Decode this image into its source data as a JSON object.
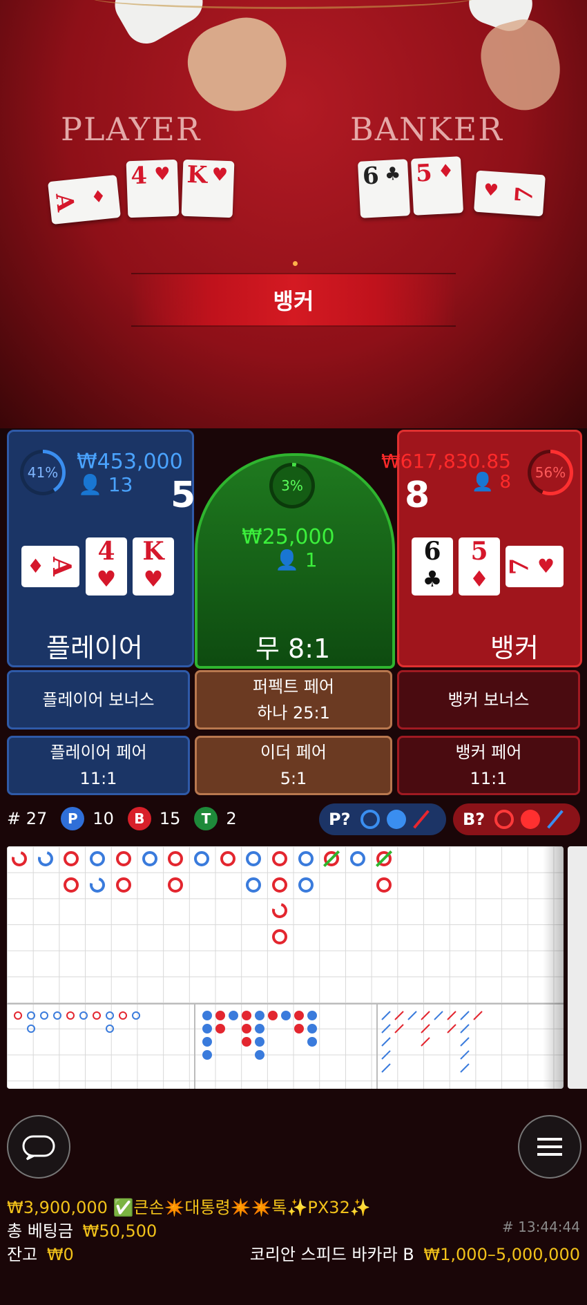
{
  "table": {
    "player_label": "PLAYER",
    "banker_label": "BANKER",
    "result_banner": "뱅커",
    "player_cards": [
      {
        "rank": "A",
        "suit": "♦",
        "color": "red"
      },
      {
        "rank": "4",
        "suit": "♥",
        "color": "red"
      },
      {
        "rank": "K",
        "suit": "♥",
        "color": "red"
      }
    ],
    "banker_cards": [
      {
        "rank": "6",
        "suit": "♣",
        "color": "black"
      },
      {
        "rank": "5",
        "suit": "♦",
        "color": "red"
      },
      {
        "rank": "7",
        "suit": "♥",
        "color": "red"
      }
    ]
  },
  "player": {
    "percent": "41%",
    "percent_value": 41,
    "amount": "₩453,000",
    "bettors": "13",
    "score": "5",
    "label": "플레이어",
    "cards": [
      {
        "rank": "A",
        "suit": "♦"
      },
      {
        "rank": "4",
        "suit": "♥"
      },
      {
        "rank": "K",
        "suit": "♥"
      }
    ]
  },
  "tie": {
    "percent": "3%",
    "percent_value": 3,
    "amount": "₩25,000",
    "bettors": "1",
    "label": "무 8:1"
  },
  "banker": {
    "percent": "56%",
    "percent_value": 56,
    "amount": "₩617,830.85",
    "bettors": "8",
    "score": "8",
    "label": "뱅커",
    "cards": [
      {
        "rank": "6",
        "suit": "♣"
      },
      {
        "rank": "5",
        "suit": "♦"
      },
      {
        "rank": "7",
        "suit": "♥"
      }
    ]
  },
  "side_bets": {
    "player_bonus": "플레이어 보너스",
    "perfect_pair_line1": "퍼펙트 페어",
    "perfect_pair_line2": "하나 25:1",
    "banker_bonus": "뱅커 보너스",
    "player_pair_line1": "플레이어 페어",
    "player_pair_line2": "11:1",
    "either_pair_line1": "이더 페어",
    "either_pair_line2": "5:1",
    "banker_pair_line1": "뱅커 페어",
    "banker_pair_line2": "11:1"
  },
  "stats": {
    "round_prefix": "#",
    "round": "27",
    "p_letter": "P",
    "p_count": "10",
    "b_letter": "B",
    "b_count": "15",
    "t_letter": "T",
    "t_count": "2",
    "player_predict": "P?",
    "banker_predict": "B?"
  },
  "colors": {
    "player_blue": "#3a7bdc",
    "banker_red": "#e3262f",
    "tie_green": "#2fb52f",
    "gold": "#f2c21a"
  },
  "bead_road": [
    {
      "col": 0,
      "row": 0,
      "color": "red",
      "mark": "partial"
    },
    {
      "col": 1,
      "row": 0,
      "color": "blue",
      "mark": "partial"
    },
    {
      "col": 2,
      "row": 0,
      "color": "red"
    },
    {
      "col": 3,
      "row": 0,
      "color": "blue"
    },
    {
      "col": 4,
      "row": 0,
      "color": "red"
    },
    {
      "col": 5,
      "row": 0,
      "color": "blue"
    },
    {
      "col": 6,
      "row": 0,
      "color": "red"
    },
    {
      "col": 7,
      "row": 0,
      "color": "blue"
    },
    {
      "col": 8,
      "row": 0,
      "color": "red"
    },
    {
      "col": 9,
      "row": 0,
      "color": "blue"
    },
    {
      "col": 10,
      "row": 0,
      "color": "red"
    },
    {
      "col": 11,
      "row": 0,
      "color": "blue"
    },
    {
      "col": 12,
      "row": 0,
      "color": "red",
      "mark": "tie"
    },
    {
      "col": 13,
      "row": 0,
      "color": "blue"
    },
    {
      "col": 14,
      "row": 0,
      "color": "red",
      "mark": "tie"
    },
    {
      "col": 2,
      "row": 1,
      "color": "red"
    },
    {
      "col": 3,
      "row": 1,
      "color": "blue",
      "mark": "partial"
    },
    {
      "col": 4,
      "row": 1,
      "color": "red"
    },
    {
      "col": 6,
      "row": 1,
      "color": "red"
    },
    {
      "col": 9,
      "row": 1,
      "color": "blue"
    },
    {
      "col": 10,
      "row": 1,
      "color": "red"
    },
    {
      "col": 11,
      "row": 1,
      "color": "blue"
    },
    {
      "col": 14,
      "row": 1,
      "color": "red"
    },
    {
      "col": 10,
      "row": 2,
      "color": "red",
      "mark": "partial"
    },
    {
      "col": 10,
      "row": 3,
      "color": "red"
    }
  ],
  "footer": {
    "chat_message": "₩3,900,000 ✅큰손✴️대통령✴️✴️톡✨PX32✨",
    "total_bet_label": "총 베팅금",
    "total_bet_value": "₩50,500",
    "balance_label": "잔고",
    "balance_value": "₩0",
    "round_id": "# 13:44:44",
    "table_name": "코리안 스피드 바카라 B",
    "limits": "₩1,000–5,000,000"
  }
}
